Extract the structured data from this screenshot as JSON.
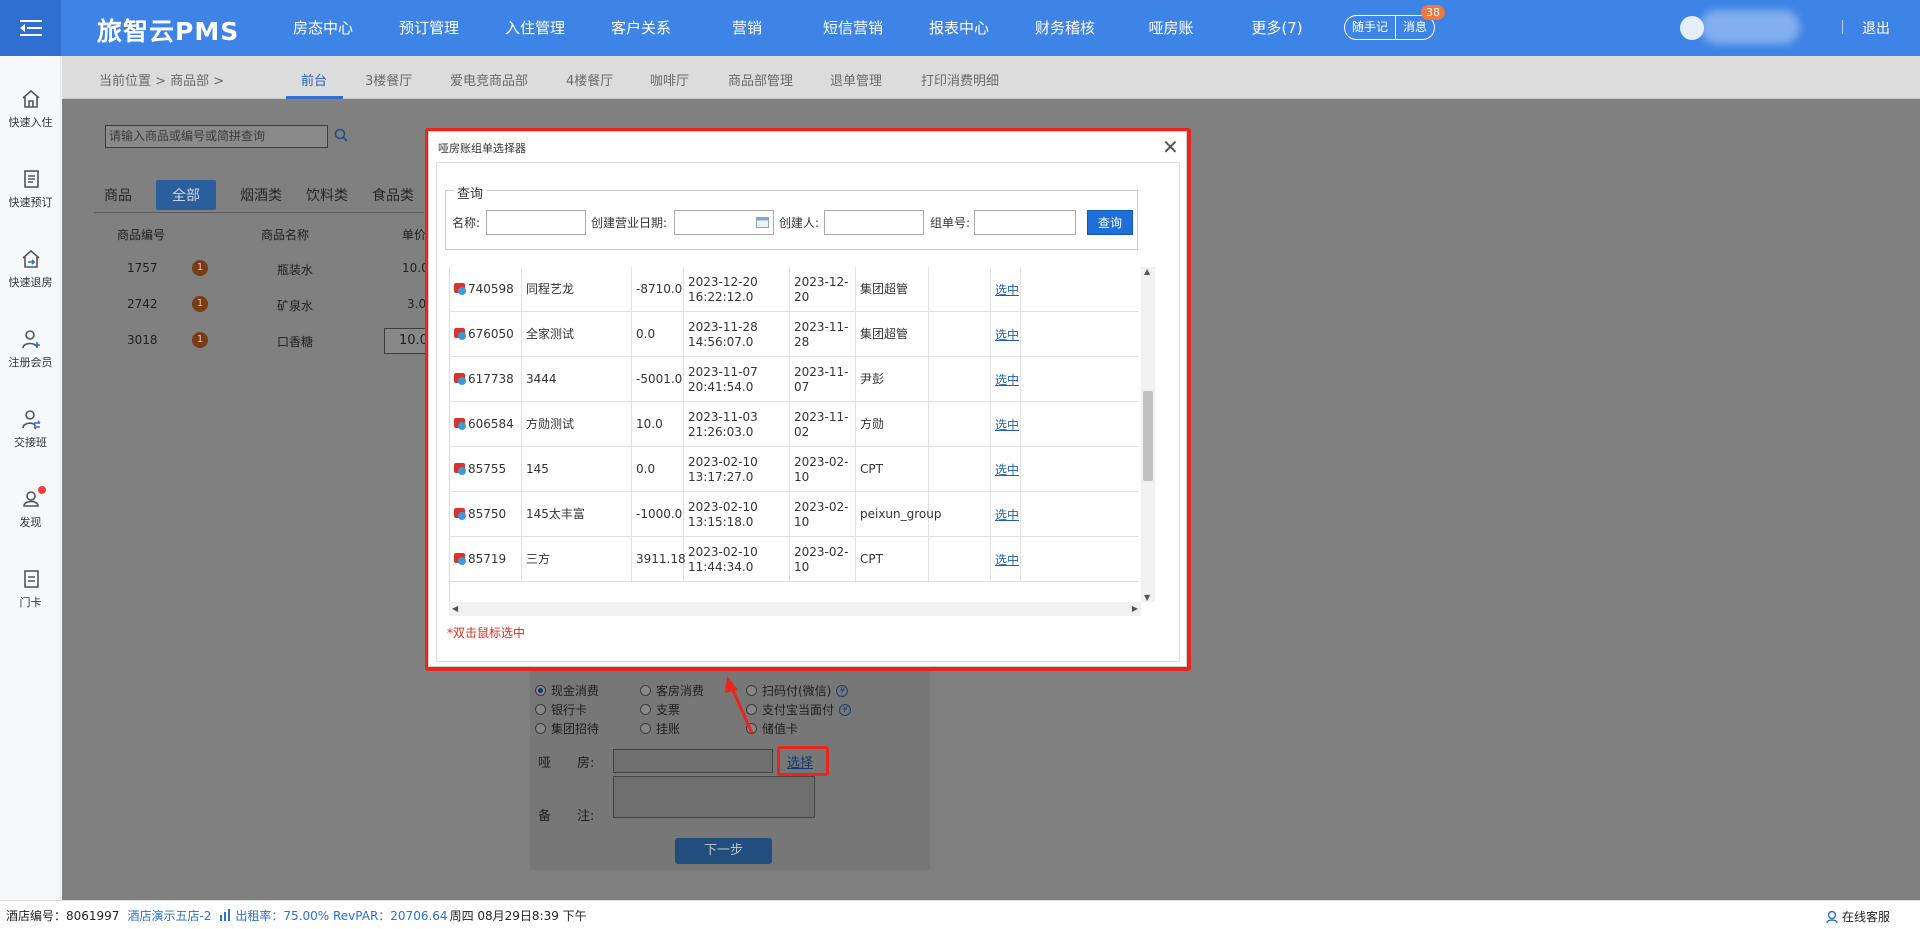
{
  "app": {
    "brand": "旅智云PMS",
    "logout": "退出",
    "notes": "随手记",
    "messages": "消息",
    "message_count": "38"
  },
  "nav": [
    "房态中心",
    "预订管理",
    "入住管理",
    "客户关系",
    "营销",
    "短信营销",
    "报表中心",
    "财务稽核",
    "哑房账",
    "更多(7)"
  ],
  "sidebar": [
    {
      "label": "快速入住",
      "icon": "home-icon"
    },
    {
      "label": "快速预订",
      "icon": "document-icon"
    },
    {
      "label": "快速退房",
      "icon": "checkout-icon"
    },
    {
      "label": "注册会员",
      "icon": "user-add-icon"
    },
    {
      "label": "交接班",
      "icon": "shift-icon"
    },
    {
      "label": "发现",
      "icon": "discover-icon"
    },
    {
      "label": "门卡",
      "icon": "card-icon"
    }
  ],
  "breadcrumb": {
    "text": "当前位置 > 商品部 >"
  },
  "subtabs": [
    "前台",
    "3楼餐厅",
    "爱电竞商品部",
    "4楼餐厅",
    "咖啡厅",
    "商品部管理",
    "退单管理",
    "打印消费明细"
  ],
  "search": {
    "placeholder": "请输入商品或编号或简拼查询"
  },
  "categories": {
    "label": "商品",
    "items": [
      "全部",
      "烟酒类",
      "饮料类",
      "食品类"
    ]
  },
  "products": {
    "headers": [
      "商品编号",
      "商品名称",
      "单价"
    ],
    "rows": [
      {
        "code": "1757",
        "badge": "1",
        "name": "瓶装水",
        "price": "10.0"
      },
      {
        "code": "2742",
        "badge": "1",
        "name": "矿泉水",
        "price": "3.0"
      },
      {
        "code": "3018",
        "badge": "1",
        "name": "口香糖",
        "price": "10.0"
      }
    ]
  },
  "payment": {
    "options": [
      {
        "label": "现金消费",
        "checked": true
      },
      {
        "label": "客房消费",
        "checked": false
      },
      {
        "label": "扫码付(微信)",
        "checked": false
      },
      {
        "label": "银行卡",
        "checked": false
      },
      {
        "label": "支票",
        "checked": false
      },
      {
        "label": "支付宝当面付",
        "checked": false
      },
      {
        "label": "集团招待",
        "checked": false
      },
      {
        "label": "挂账",
        "checked": false
      },
      {
        "label": "储值卡",
        "checked": false
      }
    ],
    "dummy_room_label": "哑　　房:",
    "select_link": "选择",
    "remark_label": "备　　注:",
    "next_button": "下一步"
  },
  "dialog": {
    "title": "哑房账组单选择器",
    "query_legend": "查询",
    "labels": {
      "name": "名称:",
      "date": "创建营业日期:",
      "creator": "创建人:",
      "group_no": "组单号:"
    },
    "query_button": "查询",
    "select_label": "选中",
    "tip": "*双击鼠标选中",
    "rows": [
      {
        "id": "740598",
        "name": "同程艺龙",
        "amount": "-8710.0",
        "created": "2023-12-20 16:22:12.0",
        "biz_date": "2023-12-20",
        "creator": "集团超管"
      },
      {
        "id": "676050",
        "name": "全家测试",
        "amount": "0.0",
        "created": "2023-11-28 14:56:07.0",
        "biz_date": "2023-11-28",
        "creator": "集团超管"
      },
      {
        "id": "617738",
        "name": "3444",
        "amount": "-5001.0",
        "created": "2023-11-07 20:41:54.0",
        "biz_date": "2023-11-07",
        "creator": "尹彭"
      },
      {
        "id": "606584",
        "name": "方勋测试",
        "amount": "10.0",
        "created": "2023-11-03 21:26:03.0",
        "biz_date": "2023-11-02",
        "creator": "方勋"
      },
      {
        "id": "85755",
        "name": "145",
        "amount": "0.0",
        "created": "2023-02-10 13:17:27.0",
        "biz_date": "2023-02-10",
        "creator": "CPT"
      },
      {
        "id": "85750",
        "name": "145太丰富",
        "amount": "-1000.0",
        "created": "2023-02-10 13:15:18.0",
        "biz_date": "2023-02-10",
        "creator": "peixun_group"
      },
      {
        "id": "85719",
        "name": "三方",
        "amount": "3911.18",
        "created": "2023-02-10 11:44:34.0",
        "biz_date": "2023-02-10",
        "creator": "CPT"
      }
    ]
  },
  "footer": {
    "hotel_no_label": "酒店编号：8061997",
    "hotel_name": "酒店演示五店-2",
    "occupancy": "出租率：75.00% RevPAR：20706.64",
    "datetime": "周四 08月29日8:39 下午",
    "service": "在线客服"
  },
  "colors": {
    "brand_blue": "#3e84e6",
    "highlight_red": "#e8261c",
    "link_blue": "#1e5fb4"
  }
}
